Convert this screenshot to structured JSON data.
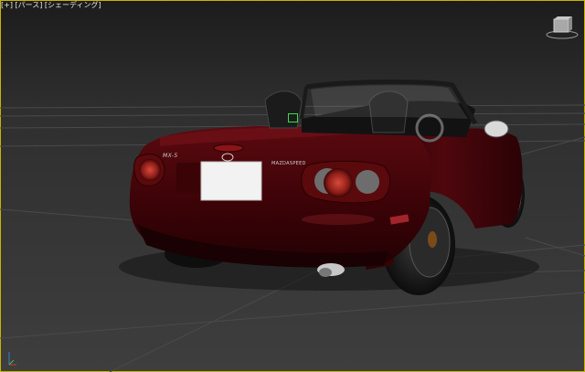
{
  "viewport": {
    "labels": {
      "plus": "[+]",
      "view": "[パース]",
      "shading": "[シェーディング]"
    }
  },
  "car": {
    "model_badge": "MX-5",
    "trim_badge": "MAZDASPEED"
  },
  "colors": {
    "body": "#4a0408",
    "highlight": "#7a141a",
    "taillight": "#c0302a",
    "selection_marker": "#35e04a",
    "viewport_border": "#c8b400"
  },
  "icons": {
    "viewcube": "viewcube-icon",
    "axis": "axis-tripod-icon"
  }
}
